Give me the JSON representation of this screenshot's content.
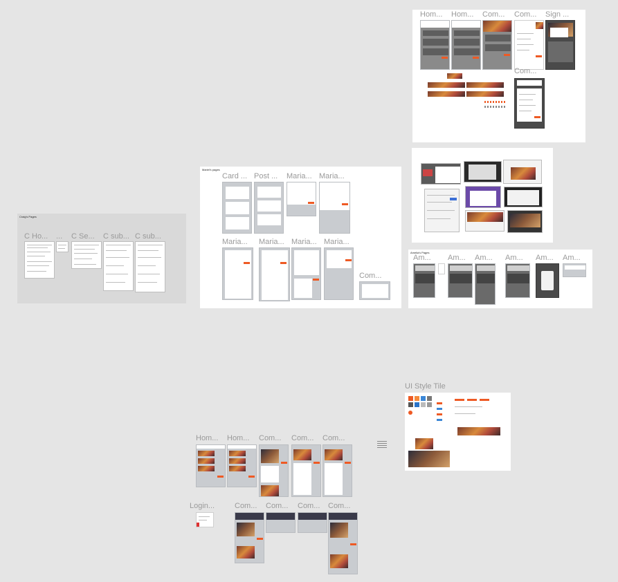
{
  "groups": {
    "craig": {
      "title": "Craig's Pages",
      "frames": [
        "C Ho...",
        "...",
        "C Se...",
        "C sub...",
        "C sub..."
      ]
    },
    "mariel": {
      "title": "Mariel's pages",
      "frames": [
        "Card ...",
        "Post ...",
        "Maria...",
        "Maria...",
        "Maria...",
        "Maria...",
        "Maria...",
        "Maria...",
        "Com..."
      ]
    },
    "top_right": {
      "frames": [
        "Hom...",
        "Hom...",
        "Com...",
        "Com...",
        "Sign ...",
        "Com..."
      ]
    },
    "amelia": {
      "title": "Amelia's Pages",
      "frames": [
        "Am...",
        "Am...",
        "Am...",
        "Am...",
        "Am...",
        "Am..."
      ]
    },
    "style_tile": {
      "label": "UI Style Tile"
    },
    "bottom": {
      "row1": [
        "Hom...",
        "Hom...",
        "Com...",
        "Com...",
        "Com..."
      ],
      "row2": [
        "Login...",
        "Com...",
        "Com...",
        "Com...",
        "Com..."
      ]
    }
  },
  "colors": {
    "canvas": "#e5e5e5",
    "accent": "#ee5a24",
    "frame_grey": "#c9ccd0",
    "dark_frame": "#4a4a4a"
  }
}
